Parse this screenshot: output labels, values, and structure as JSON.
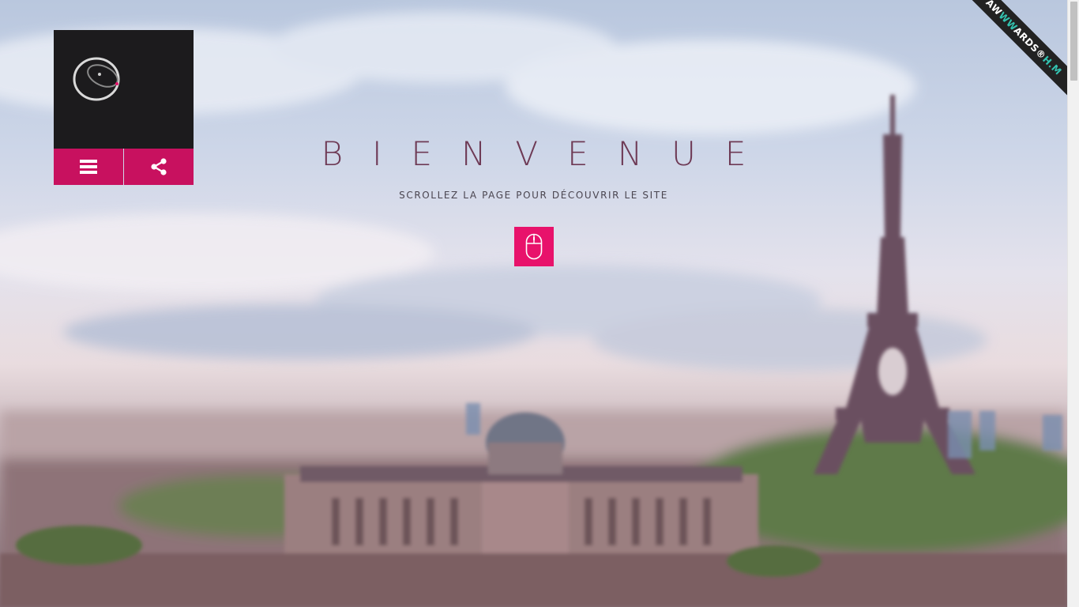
{
  "hero": {
    "title": "BIENVENUE",
    "subtitle": "SCROLLEZ LA PAGE POUR DÉCOUVRIR LE SITE"
  },
  "header": {
    "menu_icon": "hamburger-menu-icon",
    "share_icon": "share-icon",
    "logo": "orbit-logo"
  },
  "scroll_button": {
    "icon": "mouse-icon"
  },
  "ribbon": {
    "prefix": "AW",
    "highlight": "WW",
    "suffix": "ARDS",
    "mark": "®",
    "tag": "H.M"
  },
  "colors": {
    "accent": "#e8126b",
    "accent_dark": "#c8115f",
    "title": "#6e3a55",
    "logo_bg": "#1c1b1d",
    "ribbon_bg": "#222222",
    "ribbon_teal": "#33c2b0"
  }
}
